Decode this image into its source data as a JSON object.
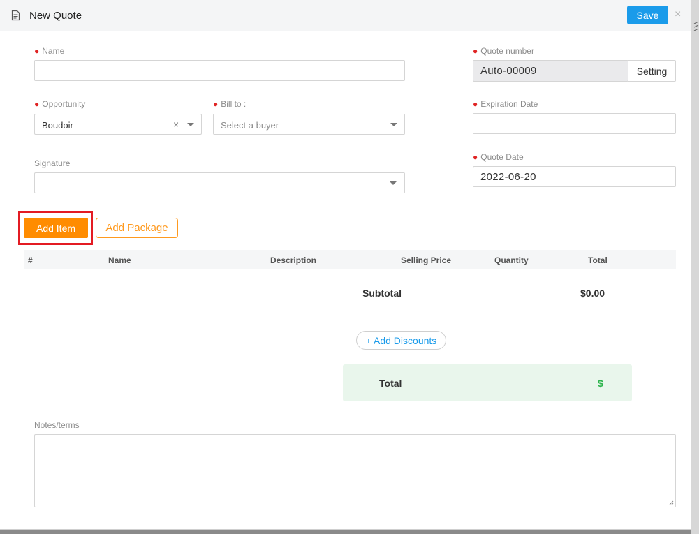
{
  "modal": {
    "title": "New Quote",
    "save_label": "Save",
    "close_symbol": "×",
    "title_icon": "document-icon"
  },
  "form": {
    "name": {
      "label": "Name",
      "value": ""
    },
    "quote_number": {
      "label": "Quote number",
      "value": "Auto-00009",
      "setting_label": "Setting"
    },
    "opportunity": {
      "label": "Opportunity",
      "value": "Boudoir",
      "clear_symbol": "×"
    },
    "bill_to": {
      "label": "Bill to :",
      "placeholder": "Select a buyer"
    },
    "expiration_date": {
      "label": "Expiration Date",
      "value": ""
    },
    "signature": {
      "label": "Signature",
      "value": ""
    },
    "quote_date": {
      "label": "Quote Date",
      "value": "2022-06-20"
    }
  },
  "items": {
    "add_item_label": "Add Item",
    "add_package_label": "Add Package",
    "columns": [
      "#",
      "Name",
      "Description",
      "Selling Price",
      "Quantity",
      "Total"
    ],
    "rows": []
  },
  "summary": {
    "subtotal_label": "Subtotal",
    "subtotal_value": "$0.00",
    "add_discounts_label": "+ Add Discounts",
    "total_label": "Total",
    "total_value": "$"
  },
  "notes": {
    "label": "Notes/terms",
    "value": ""
  },
  "colors": {
    "primary": "#1a9bea",
    "accent_orange": "#ff8c00",
    "required_dot": "#e02424",
    "highlight_frame": "#e31b23",
    "total_green": "#2bb34b",
    "total_bg": "#e9f6ec"
  }
}
